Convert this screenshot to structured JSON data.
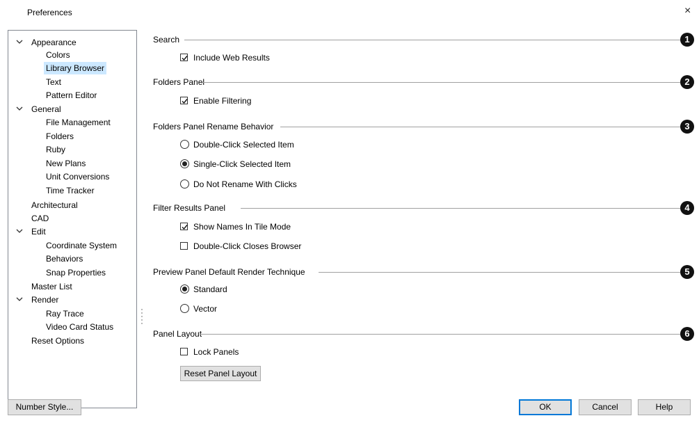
{
  "window": {
    "title": "Preferences",
    "close_glyph": "×"
  },
  "tree": {
    "items": [
      {
        "label": "Appearance",
        "expanded": true
      },
      {
        "label": "Colors"
      },
      {
        "label": "Library Browser",
        "selected": true
      },
      {
        "label": "Text"
      },
      {
        "label": "Pattern Editor"
      },
      {
        "label": "General",
        "expanded": true
      },
      {
        "label": "File Management"
      },
      {
        "label": "Folders"
      },
      {
        "label": "Ruby"
      },
      {
        "label": "New Plans"
      },
      {
        "label": "Unit Conversions"
      },
      {
        "label": "Time Tracker"
      },
      {
        "label": "Architectural"
      },
      {
        "label": "CAD"
      },
      {
        "label": "Edit",
        "expanded": true
      },
      {
        "label": "Coordinate System"
      },
      {
        "label": "Behaviors"
      },
      {
        "label": "Snap Properties"
      },
      {
        "label": "Master List"
      },
      {
        "label": "Render",
        "expanded": true
      },
      {
        "label": "Ray Trace"
      },
      {
        "label": "Video Card Status"
      },
      {
        "label": "Reset Options"
      }
    ]
  },
  "sections": {
    "search": {
      "title": "Search",
      "badge": "1",
      "include_web_results": {
        "label": "Include Web Results",
        "checked": true
      }
    },
    "folders_panel": {
      "title": "Folders Panel",
      "badge": "2",
      "enable_filtering": {
        "label": "Enable Filtering",
        "checked": true
      }
    },
    "rename_behavior": {
      "title": "Folders Panel Rename Behavior",
      "badge": "3",
      "options": [
        {
          "label": "Double-Click Selected Item",
          "selected": false
        },
        {
          "label": "Single-Click Selected Item",
          "selected": true
        },
        {
          "label": "Do Not Rename With Clicks",
          "selected": false
        }
      ]
    },
    "filter_results": {
      "title": "Filter Results Panel",
      "badge": "4",
      "show_names": {
        "label": "Show Names In Tile Mode",
        "checked": true
      },
      "double_click_closes": {
        "label": "Double-Click Closes Browser",
        "checked": false
      }
    },
    "render_technique": {
      "title": "Preview Panel Default Render Technique",
      "badge": "5",
      "options": [
        {
          "label": "Standard",
          "selected": true
        },
        {
          "label": "Vector",
          "selected": false
        }
      ]
    },
    "panel_layout": {
      "title": "Panel Layout",
      "badge": "6",
      "lock_panels": {
        "label": "Lock Panels",
        "checked": false
      },
      "reset_button": "Reset Panel Layout"
    }
  },
  "buttons": {
    "number_style": "Number Style...",
    "ok": "OK",
    "cancel": "Cancel",
    "help": "Help"
  },
  "colors": {
    "selection": "#cce8ff",
    "default_button_border": "#0078d7",
    "badge": "#111111"
  }
}
